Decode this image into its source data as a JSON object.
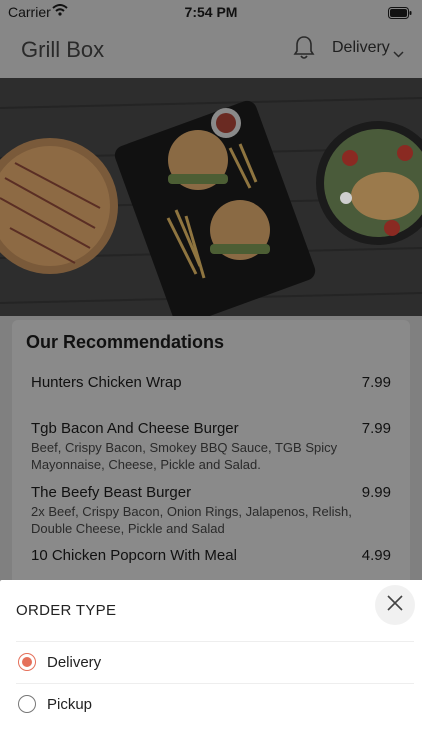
{
  "status": {
    "carrier": "Carrier",
    "time": "7:54 PM"
  },
  "header": {
    "title": "Grill Box",
    "order_mode": "Delivery"
  },
  "recommendations": {
    "title": "Our Recommendations",
    "items": [
      {
        "name": "Hunters Chicken Wrap",
        "price": "7.99",
        "desc": ""
      },
      {
        "name": "Tgb Bacon And Cheese Burger",
        "price": "7.99",
        "desc": "Beef, Crispy Bacon, Smokey BBQ Sauce, TGB Spicy Mayonnaise, Cheese, Pickle and Salad."
      },
      {
        "name": "The Beefy Beast Burger",
        "price": "9.99",
        "desc": "2x Beef, Crispy Bacon, Onion Rings, Jalapenos, Relish, Double Cheese, Pickle and Salad"
      },
      {
        "name": "10 Chicken Popcorn With Meal",
        "price": "4.99",
        "desc": ""
      }
    ]
  },
  "order_type": {
    "title": "ORDER TYPE",
    "options": [
      {
        "label": "Delivery",
        "selected": true
      },
      {
        "label": "Pickup",
        "selected": false
      }
    ]
  },
  "colors": {
    "accent": "#e5705a",
    "overlay": "#808080"
  }
}
